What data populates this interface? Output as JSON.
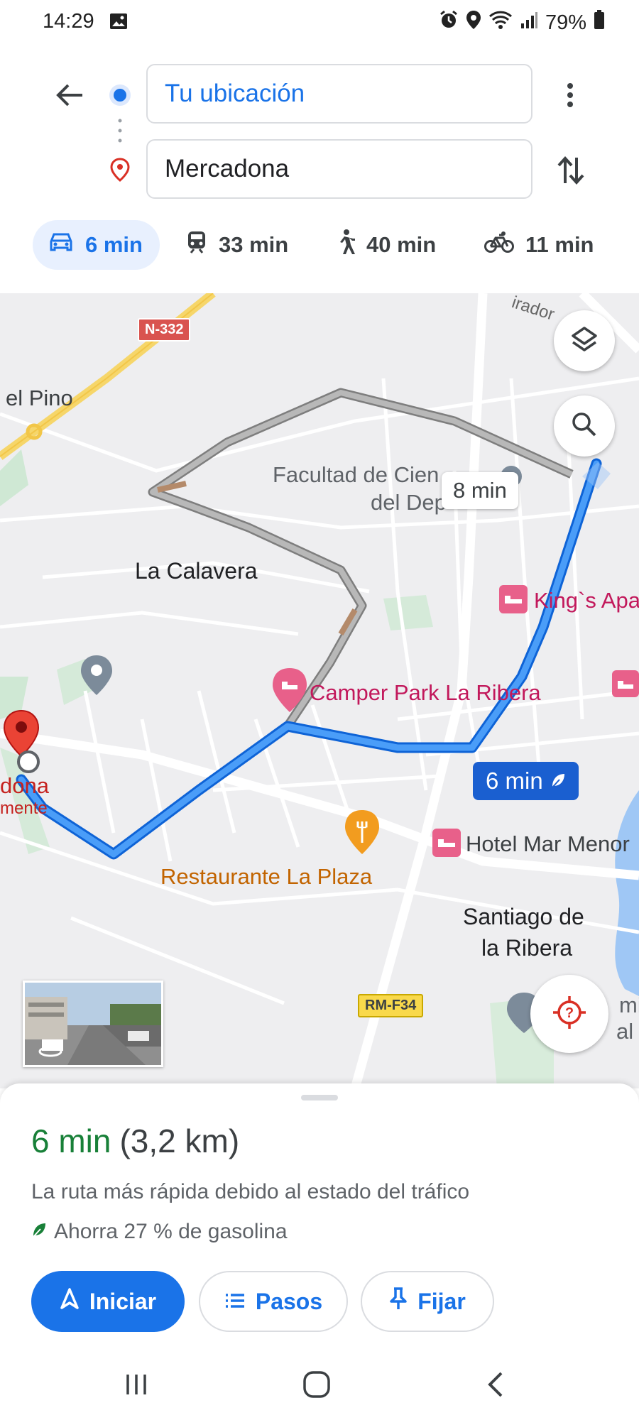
{
  "status_bar": {
    "time": "14:29",
    "battery": "79%"
  },
  "search": {
    "origin": "Tu ubicación",
    "destination": "Mercadona"
  },
  "modes": [
    {
      "name": "car",
      "time": "6 min"
    },
    {
      "name": "transit",
      "time": "33 min"
    },
    {
      "name": "walk",
      "time": "40 min"
    },
    {
      "name": "bike",
      "time": "11 min"
    }
  ],
  "map": {
    "road_shields": {
      "n332": "N-332",
      "rmf34": "RM-F34"
    },
    "labels": {
      "el_pino": "el Pino",
      "facultad_1": "Facultad de Cien",
      "facultad_2": "del Dep",
      "mirador": "irador",
      "la_calavera": "La Calavera",
      "kings": "King`s Apa",
      "camper": "Camper Park La Ribera",
      "hotel": "Hotel Mar Menor",
      "restaurante": "Restaurante La Plaza",
      "santiago_1": "Santiago de",
      "santiago_2": "la Ribera",
      "mercadona_1": "dona",
      "mercadona_2": "mente",
      "edge_1": "mi",
      "edge_2": "al c"
    },
    "alt_route_time": "8 min",
    "main_route_time": "6 min"
  },
  "summary": {
    "duration": "6 min",
    "distance": "(3,2 km)",
    "description": "La ruta más rápida debido al estado del tráfico",
    "fuel": "Ahorra 27 % de gasolina"
  },
  "actions": {
    "start": "Iniciar",
    "steps": "Pasos",
    "pin": "Fijar"
  },
  "colors": {
    "blue": "#1a73e8",
    "green": "#188038",
    "red": "#d93025"
  }
}
